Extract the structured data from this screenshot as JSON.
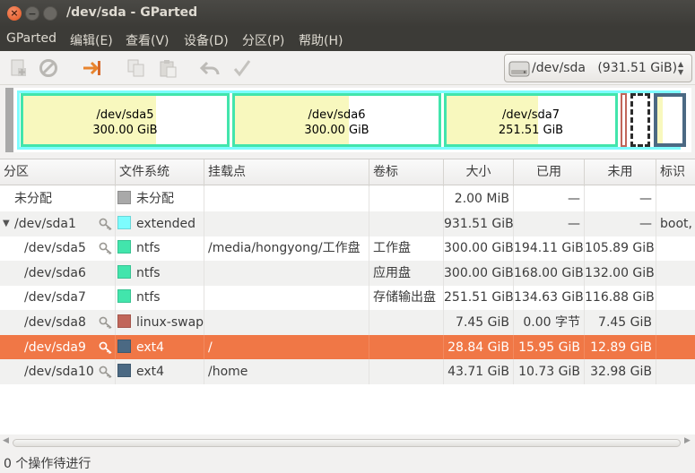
{
  "window": {
    "title": "/dev/sda - GParted"
  },
  "menu": [
    "GParted",
    "编辑(E)",
    "查看(V)",
    "设备(D)",
    "分区(P)",
    "帮助(H)"
  ],
  "toolbar": {
    "buttons": [
      "new-icon",
      "delete-icon",
      "resize-move-icon",
      "copy-icon",
      "paste-icon",
      "undo-icon",
      "apply-icon"
    ]
  },
  "device_selector": {
    "device": "/dev/sda",
    "size": "(931.51 GiB)"
  },
  "graphic": {
    "segments": [
      {
        "name": "/dev/sda5",
        "size": "300.00 GiB",
        "used_fraction": 0.65
      },
      {
        "name": "/dev/sda6",
        "size": "300.00 GiB",
        "used_fraction": 0.56
      },
      {
        "name": "/dev/sda7",
        "size": "251.51 GiB",
        "used_fraction": 0.54
      }
    ]
  },
  "columns": [
    "分区",
    "文件系统",
    "挂载点",
    "卷标",
    "大小",
    "已用",
    "未用",
    "标识"
  ],
  "rows": [
    {
      "partition": "未分配",
      "fs": "未分配",
      "fs_color": "#a9a9a9",
      "mount": "",
      "label": "",
      "size": "2.00 MiB",
      "used": "—",
      "unused": "—",
      "flags": "",
      "locked": false,
      "indent": 0,
      "expander": false
    },
    {
      "partition": "/dev/sda1",
      "fs": "extended",
      "fs_color": "#7dfcfe",
      "mount": "",
      "label": "",
      "size": "931.51 GiB",
      "used": "—",
      "unused": "—",
      "flags": "boot,",
      "locked": true,
      "indent": 0,
      "expander": true
    },
    {
      "partition": "/dev/sda5",
      "fs": "ntfs",
      "fs_color": "#42e5ac",
      "mount": "/media/hongyong/工作盘",
      "label": "工作盘",
      "size": "300.00 GiB",
      "used": "194.11 GiB",
      "unused": "105.89 GiB",
      "flags": "",
      "locked": true,
      "indent": 1,
      "expander": false
    },
    {
      "partition": "/dev/sda6",
      "fs": "ntfs",
      "fs_color": "#42e5ac",
      "mount": "",
      "label": "应用盘",
      "size": "300.00 GiB",
      "used": "168.00 GiB",
      "unused": "132.00 GiB",
      "flags": "",
      "locked": false,
      "indent": 1,
      "expander": false
    },
    {
      "partition": "/dev/sda7",
      "fs": "ntfs",
      "fs_color": "#42e5ac",
      "mount": "",
      "label": "存储输出盘",
      "size": "251.51 GiB",
      "used": "134.63 GiB",
      "unused": "116.88 GiB",
      "flags": "",
      "locked": false,
      "indent": 1,
      "expander": false
    },
    {
      "partition": "/dev/sda8",
      "fs": "linux-swap",
      "fs_color": "#c1665a",
      "mount": "",
      "label": "",
      "size": "7.45 GiB",
      "used": "0.00 字节",
      "unused": "7.45 GiB",
      "flags": "",
      "locked": true,
      "indent": 1,
      "expander": false
    },
    {
      "partition": "/dev/sda9",
      "fs": "ext4",
      "fs_color": "#4b6983",
      "mount": "/",
      "label": "",
      "size": "28.84 GiB",
      "used": "15.95 GiB",
      "unused": "12.89 GiB",
      "flags": "",
      "locked": true,
      "indent": 1,
      "expander": false,
      "selected": true
    },
    {
      "partition": "/dev/sda10",
      "fs": "ext4",
      "fs_color": "#4b6983",
      "mount": "/home",
      "label": "",
      "size": "43.71 GiB",
      "used": "10.73 GiB",
      "unused": "32.98 GiB",
      "flags": "",
      "locked": true,
      "indent": 1,
      "expander": false
    }
  ],
  "status": {
    "text": "0 个操作待进行"
  }
}
